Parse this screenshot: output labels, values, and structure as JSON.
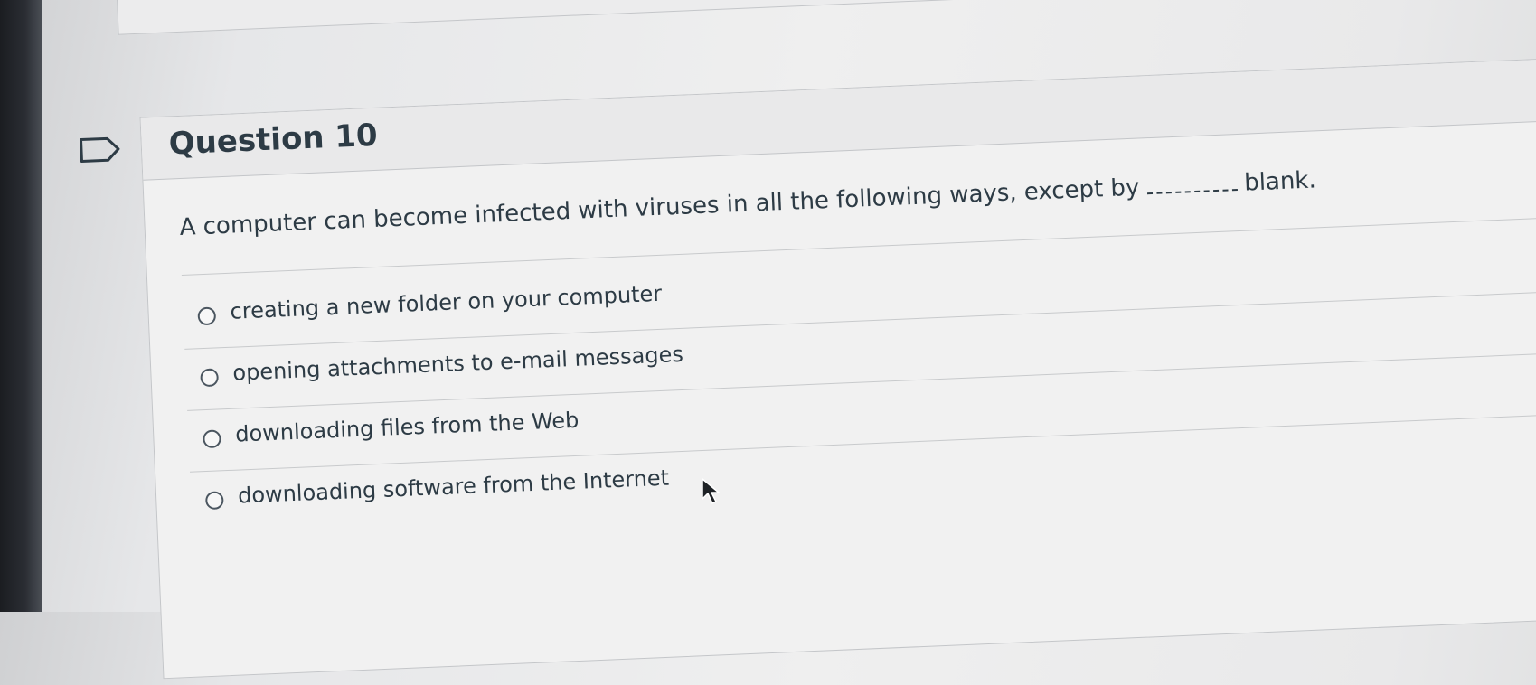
{
  "question": {
    "title": "Question 10",
    "text_before_blank": "A computer can become infected with viruses in all the following ways, except by",
    "text_after_blank": "blank."
  },
  "answers": [
    {
      "label": "creating a new folder on your computer",
      "selected": false
    },
    {
      "label": "opening attachments to e-mail messages",
      "selected": false
    },
    {
      "label": "downloading files from the Web",
      "selected": false
    },
    {
      "label": "downloading software from the Internet",
      "selected": false
    }
  ],
  "icons": {
    "flag": "flag-icon",
    "cursor": "mouse-pointer-icon"
  },
  "colors": {
    "text": "#2d3b45",
    "header_bg": "#e9e9ea",
    "card_bg": "#f1f1f1",
    "border": "#c4c6c9"
  }
}
